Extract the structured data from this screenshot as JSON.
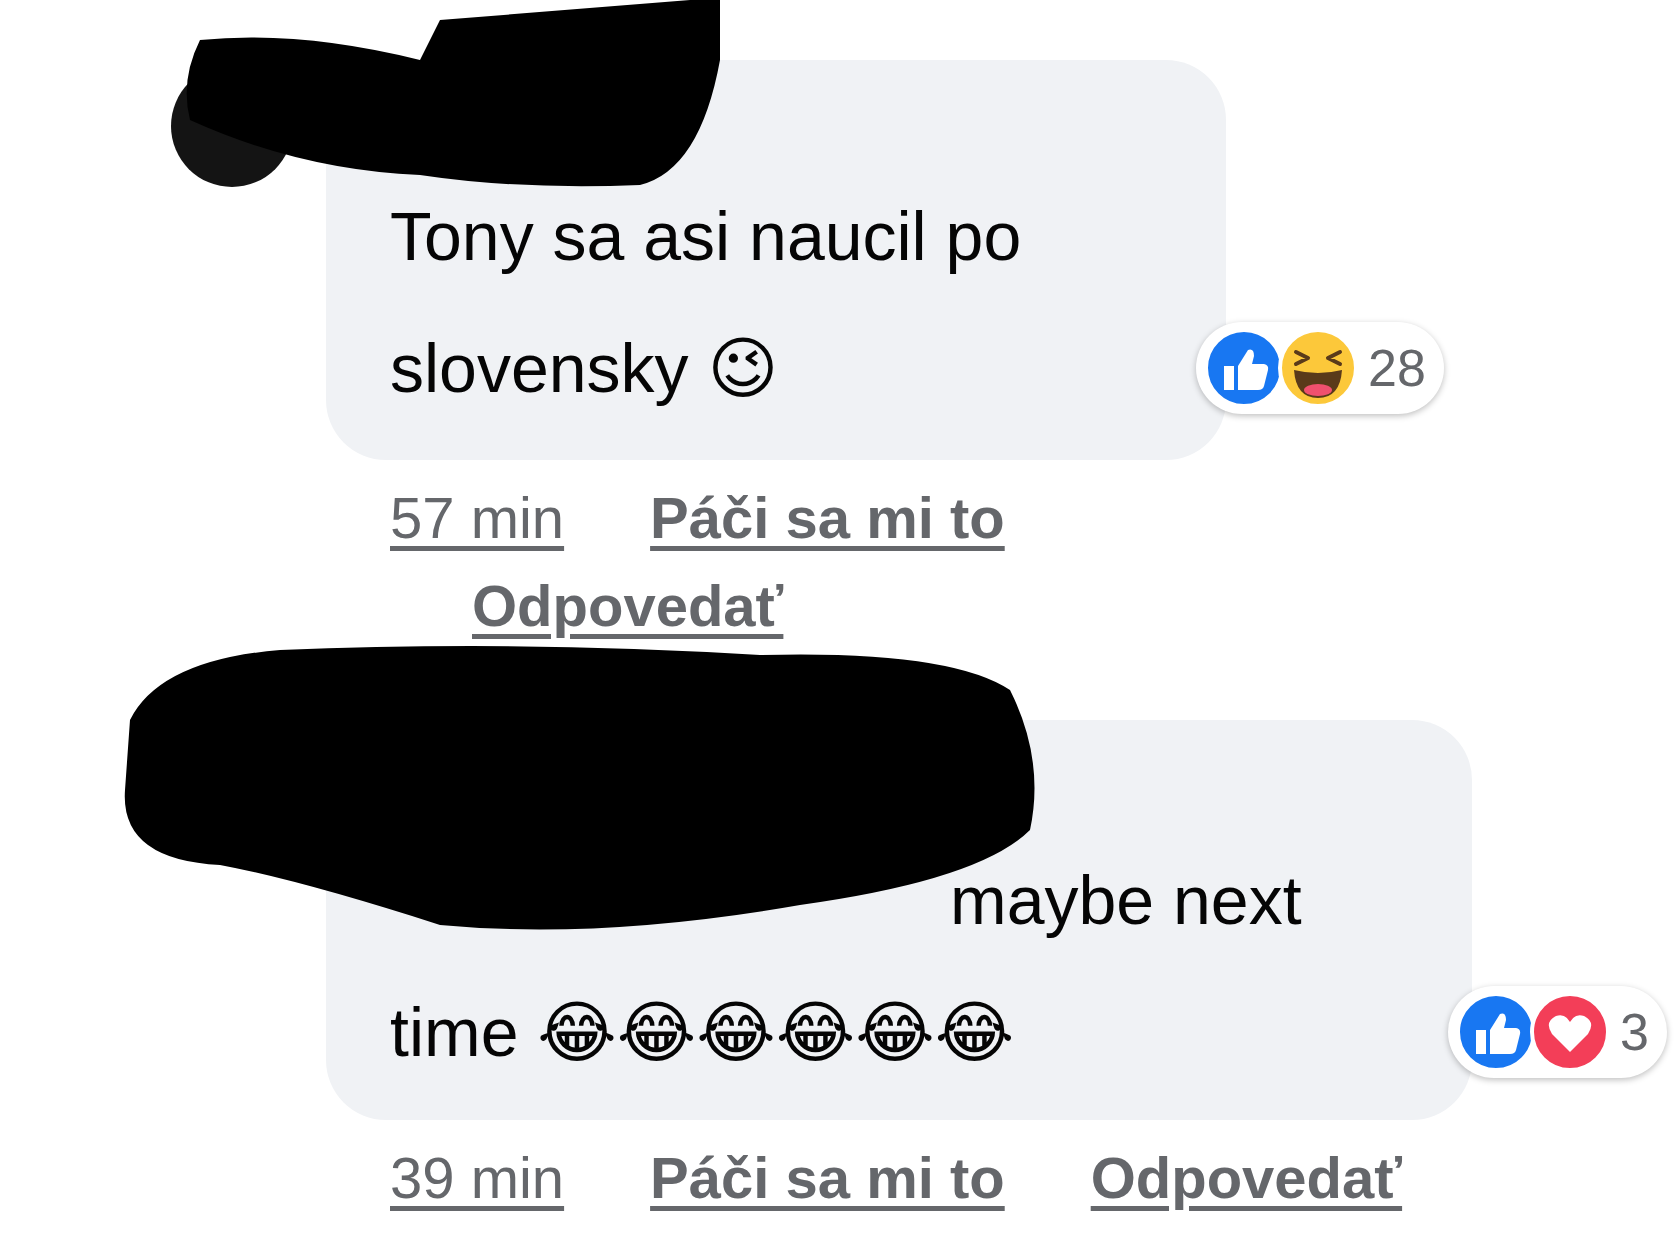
{
  "comments": [
    {
      "text": "Tony sa asi naucil po slovensky 😉",
      "tag_hidden": false,
      "reactions": {
        "icons": [
          {
            "kind": "like"
          },
          {
            "kind": "haha"
          }
        ],
        "count": "28"
      },
      "actions": [
        "57 min",
        "Páči sa mi to",
        "Odpovedať"
      ]
    },
    {
      "text": "maybe next time 😂😂😂😂😂😂",
      "tag_hidden": true,
      "reactions": {
        "icons": [
          {
            "kind": "like"
          },
          {
            "kind": "love"
          }
        ],
        "count": "3"
      },
      "actions": [
        "39 min",
        "Páči sa mi to",
        "Odpovedať"
      ]
    }
  ]
}
